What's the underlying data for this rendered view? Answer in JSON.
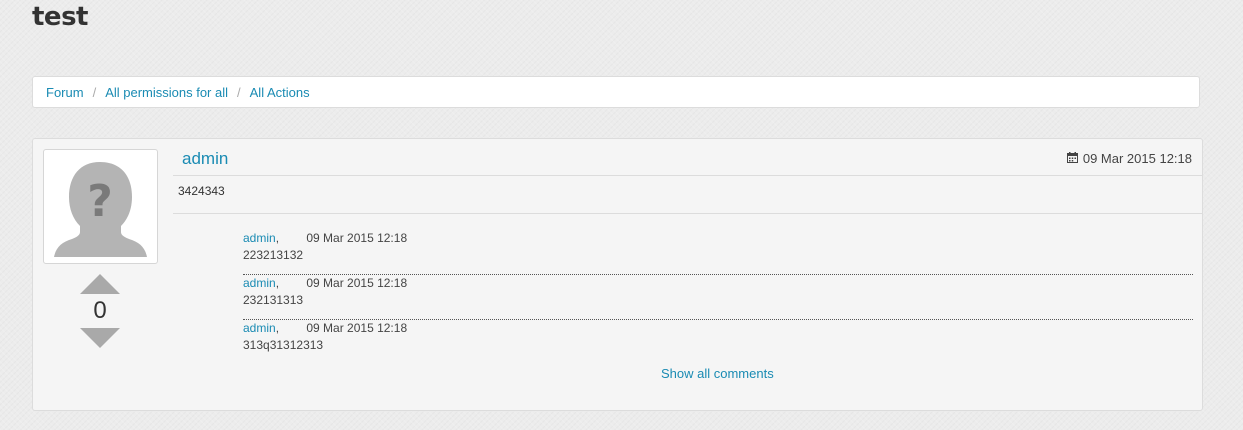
{
  "page": {
    "title": "test"
  },
  "breadcrumb": {
    "items": [
      {
        "label": "Forum"
      },
      {
        "label": "All permissions for all"
      },
      {
        "label": "All Actions"
      }
    ],
    "separator": "/"
  },
  "post": {
    "avatar_icon": "default-user-avatar-icon",
    "vote_count": "0",
    "author": "admin",
    "date": "09 Mar 2015 12:18",
    "date_icon": "calendar-icon",
    "body": "3424343",
    "comments": [
      {
        "author": "admin",
        "date": "09 Mar 2015 12:18",
        "text": "223213132"
      },
      {
        "author": "admin",
        "date": "09 Mar 2015 12:18",
        "text": "232131313"
      },
      {
        "author": "admin",
        "date": "09 Mar 2015 12:18",
        "text": "313q31312313"
      }
    ],
    "show_all_label": "Show all comments"
  },
  "colors": {
    "link": "#1a8bb3",
    "vote_arrow": "#a9a9a9",
    "background": "#ececec",
    "card": "#f5f5f5"
  }
}
